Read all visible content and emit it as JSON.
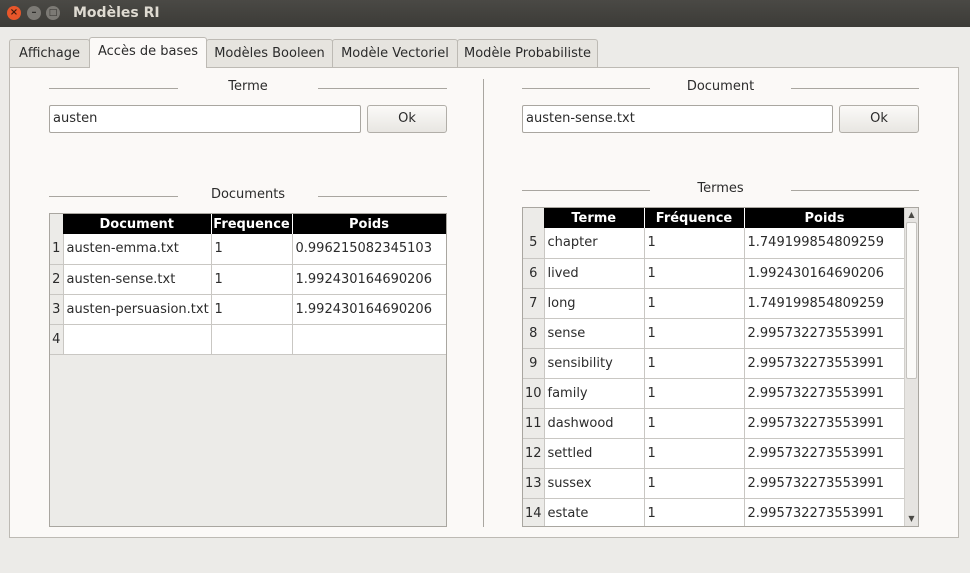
{
  "window": {
    "title": "Modèles RI",
    "controls": {
      "close": "×",
      "minimize": "–",
      "maximize": "□"
    }
  },
  "tabs": [
    {
      "label": "Affichage"
    },
    {
      "label": "Accès de bases"
    },
    {
      "label": "Modèles Booleen"
    },
    {
      "label": "Modèle Vectoriel"
    },
    {
      "label": "Modèle Probabiliste"
    }
  ],
  "active_tab": "Accès de bases",
  "left": {
    "terme_section": "Terme",
    "terme_input": "austen",
    "ok_label": "Ok",
    "documents_section": "Documents",
    "table": {
      "headers": [
        "Document",
        "Frequence",
        "Poids"
      ],
      "rows": [
        {
          "num": "1",
          "document": "austen-emma.txt",
          "freq": "1",
          "poids": "0.996215082345103"
        },
        {
          "num": "2",
          "document": "austen-sense.txt",
          "freq": "1",
          "poids": "1.992430164690206"
        },
        {
          "num": "3",
          "document": "austen-persuasion.txt",
          "freq": "1",
          "poids": "1.992430164690206"
        },
        {
          "num": "4",
          "document": "",
          "freq": "",
          "poids": ""
        }
      ]
    }
  },
  "right": {
    "document_section": "Document",
    "document_input": "austen-sense.txt",
    "ok_label": "Ok",
    "termes_section": "Termes",
    "table": {
      "headers": [
        "Terme",
        "Fréquence",
        "Poids"
      ],
      "rows": [
        {
          "num": "5",
          "terme": "chapter",
          "freq": "1",
          "poids": "1.749199854809259"
        },
        {
          "num": "6",
          "terme": "lived",
          "freq": "1",
          "poids": "1.992430164690206"
        },
        {
          "num": "7",
          "terme": "long",
          "freq": "1",
          "poids": "1.749199854809259"
        },
        {
          "num": "8",
          "terme": "sense",
          "freq": "1",
          "poids": "2.995732273553991"
        },
        {
          "num": "9",
          "terme": "sensibility",
          "freq": "1",
          "poids": "2.995732273553991"
        },
        {
          "num": "10",
          "terme": "family",
          "freq": "1",
          "poids": "2.995732273553991"
        },
        {
          "num": "11",
          "terme": "dashwood",
          "freq": "1",
          "poids": "2.995732273553991"
        },
        {
          "num": "12",
          "terme": "settled",
          "freq": "1",
          "poids": "2.995732273553991"
        },
        {
          "num": "13",
          "terme": "sussex",
          "freq": "1",
          "poids": "2.995732273553991"
        },
        {
          "num": "14",
          "terme": "estate",
          "freq": "1",
          "poids": "2.995732273553991"
        }
      ]
    },
    "scrollbar": {
      "up": "▲",
      "down": "▼"
    }
  }
}
